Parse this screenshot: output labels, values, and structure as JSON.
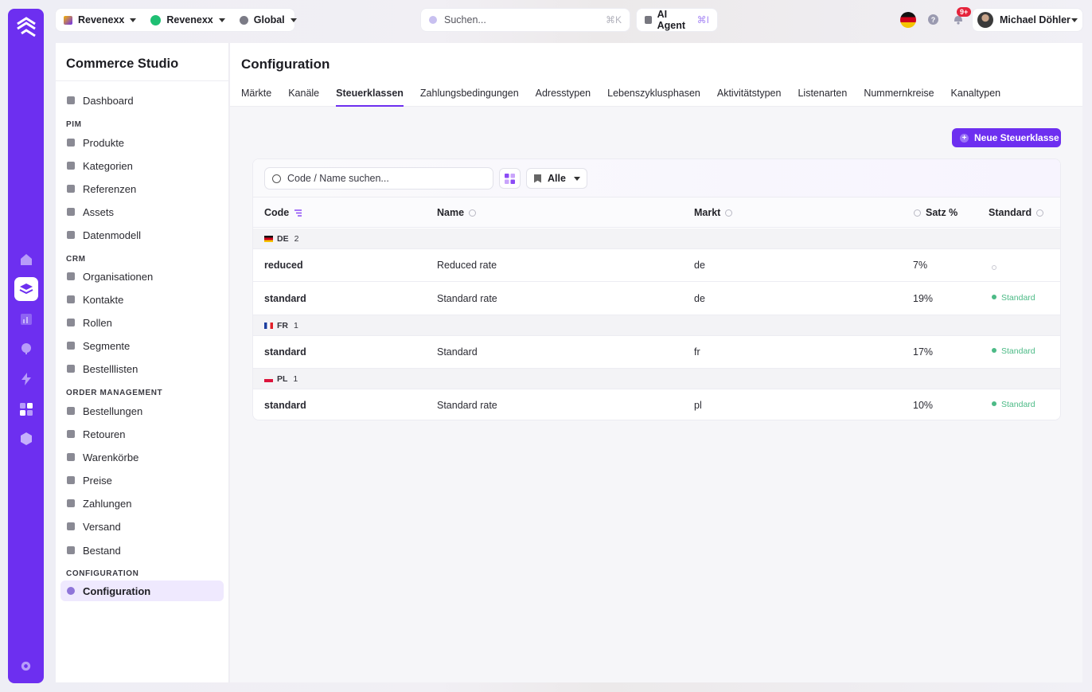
{
  "topbar": {
    "tenant": [
      {
        "label": "Revenexx",
        "icon": "revenexx-logo-icon"
      },
      {
        "label": "Revenexx",
        "icon": "green-dot-icon",
        "color": "#1fbf73"
      },
      {
        "label": "Global",
        "icon": "globe-icon"
      }
    ],
    "search_placeholder": "Suchen...",
    "search_shortcut": "⌘K",
    "agent_label": "AI Agent",
    "agent_shortcut": "⌘I",
    "help": "?",
    "notification_badge": "9+",
    "user_name": "Michael Döhler"
  },
  "sidebar": {
    "title": "Commerce Studio",
    "items": [
      {
        "label": "Dashboard"
      }
    ],
    "groups": [
      {
        "label": "PIM",
        "items": [
          "Produkte",
          "Kategorien",
          "Referenzen",
          "Assets",
          "Datenmodell"
        ]
      },
      {
        "label": "CRM",
        "items": [
          "Organisationen",
          "Kontakte",
          "Rollen",
          "Segmente",
          "Bestelllisten"
        ]
      },
      {
        "label": "ORDER MANAGEMENT",
        "items": [
          "Bestellungen",
          "Retouren",
          "Warenkörbe",
          "Preise",
          "Zahlungen",
          "Versand",
          "Bestand"
        ]
      },
      {
        "label": "CONFIGURATION",
        "items": [
          "Configuration"
        ]
      }
    ],
    "active": "Configuration"
  },
  "main": {
    "title": "Configuration",
    "tabs": [
      "Märkte",
      "Kanäle",
      "Steuerklassen",
      "Zahlungsbedingungen",
      "Adresstypen",
      "Lebenszyklusphasen",
      "Aktivitätstypen",
      "Listenarten",
      "Nummernkreise",
      "Kanaltypen"
    ],
    "active_tab": "Steuerklassen",
    "new_button": "Neue Steuerklasse",
    "table_search_placeholder": "Code / Name suchen...",
    "filter_label": "Alle",
    "columns": [
      "Code",
      "Name",
      "Markt",
      "Satz %",
      "Standard"
    ],
    "groups": [
      {
        "code": "DE",
        "count": "2",
        "rows": [
          {
            "code": "reduced",
            "name": "Reduced rate",
            "market": "de",
            "rate": "7%",
            "standard": ""
          },
          {
            "code": "standard",
            "name": "Standard rate",
            "market": "de",
            "rate": "19%",
            "standard": "Standard"
          }
        ]
      },
      {
        "code": "FR",
        "count": "1",
        "rows": [
          {
            "code": "standard",
            "name": "Standard",
            "market": "fr",
            "rate": "17%",
            "standard": "Standard"
          }
        ]
      },
      {
        "code": "PL",
        "count": "1",
        "rows": [
          {
            "code": "standard",
            "name": "Standard rate",
            "market": "pl",
            "rate": "10%",
            "standard": "Standard"
          }
        ]
      }
    ]
  },
  "colors": {
    "accent": "#6d2ff0",
    "standard_green": "#4cba86"
  }
}
